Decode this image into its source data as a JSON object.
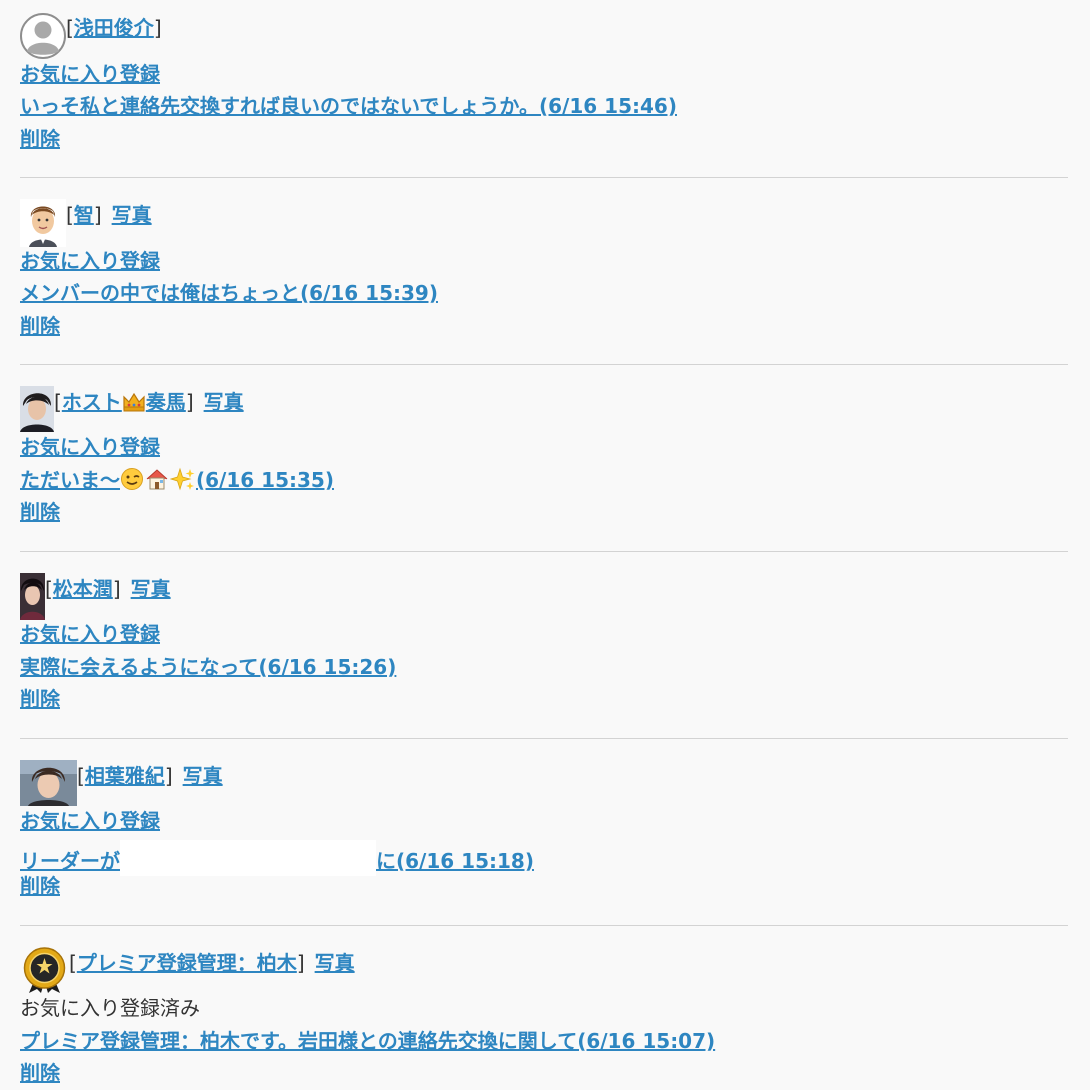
{
  "labels": {
    "favorite_register": "お気に入り登録",
    "favorite_registered": "お気に入り登録済み",
    "delete": "削除",
    "photo": "写真",
    "bracket_open": "[",
    "bracket_close": "]"
  },
  "entries": [
    {
      "name": "浅田俊介",
      "message": "いっそ私と連絡先交換すれば良いのではないでしょうか。(6/16 15:46)"
    },
    {
      "name": "智",
      "message": "メンバーの中では俺はちょっと(6/16 15:39)"
    },
    {
      "name_part1": "ホスト",
      "name_part2": "奏馬",
      "message_text": "ただいま〜",
      "message_time": "(6/16 15:35)"
    },
    {
      "name": "松本潤",
      "message": "実際に会えるようになって(6/16 15:26)"
    },
    {
      "name": "相葉雅紀",
      "message_before": "リーダーが",
      "message_after": "に(6/16 15:18)"
    },
    {
      "name": "プレミア登録管理：柏木",
      "message": "プレミア登録管理：柏木です。岩田様との連絡先交換に関して(6/16 15:07)"
    }
  ],
  "colors": {
    "link": "#2e86c1",
    "text": "#333333",
    "background": "#f9f9f9",
    "divider": "#d3d3d3"
  },
  "icons": {
    "entry1_avatar": "default-user-icon",
    "entry2_avatar": "cartoon-man-avatar",
    "entry3_avatar": "user-photo",
    "entry3_name_emoji": "crown-icon",
    "entry3_message_emojis": [
      "wink-face-icon",
      "house-icon",
      "sparkles-icon"
    ],
    "entry4_avatar": "user-photo",
    "entry5_avatar": "user-photo",
    "entry6_avatar": "premium-medal-icon"
  }
}
